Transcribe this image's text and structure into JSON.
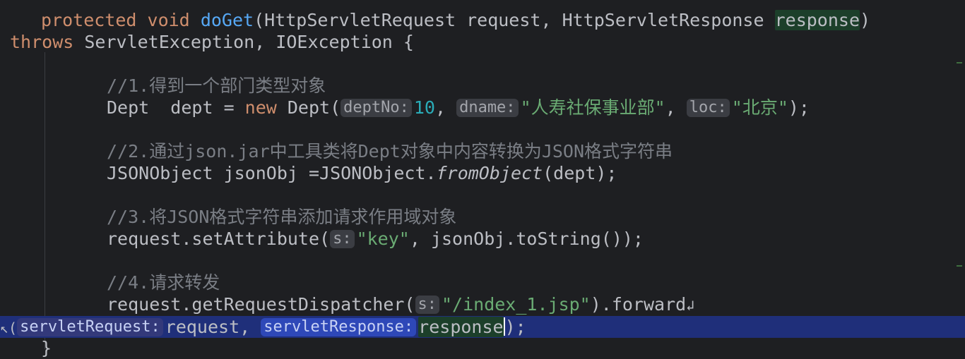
{
  "editor": {
    "lines": {
      "l1": {
        "kw1": "protected",
        "kw2": "void",
        "method": "doGet",
        "params": "(HttpServletRequest request, HttpServletResponse ",
        "param_hl": "response",
        "close": ")"
      },
      "l2": {
        "kw": "throws",
        "rest": " ServletException, IOException {"
      },
      "c1": "//1.得到一个部门类型对象",
      "l3": {
        "type": "Dept  dept = ",
        "kw": "new",
        "ctor": " Dept(",
        "hint1": "deptNo:",
        "num": "10",
        "comma1": ", ",
        "hint2": "dname:",
        "str1": "\"人寿社保事业部\"",
        "comma2": ", ",
        "hint3": "loc:",
        "str2": "\"北京\"",
        "end": ");"
      },
      "c2": "//2.通过json.jar中工具类将Dept对象中内容转换为JSON格式字符串",
      "l4": {
        "pre": "JSONObject jsonObj =JSONObject.",
        "method": "fromObject",
        "post": "(dept);"
      },
      "c3": "//3.将JSON格式字符串添加请求作用域对象",
      "l5": {
        "pre": "request.setAttribute(",
        "hint": "s:",
        "str": "\"key\"",
        "post": ", jsonObj.toString());"
      },
      "c4": "//4.请求转发",
      "l6": {
        "pre": "request.getRequestDispatcher(",
        "hint": "s:",
        "str": "\"/index_1.jsp\"",
        "post": ").forward",
        "wrap": "↲"
      },
      "l7": {
        "lead": "↖(",
        "hint1": "servletRequest:",
        "arg1": "request, ",
        "hint2": "servletResponse:",
        "arg2": "response",
        "end": ");"
      },
      "l8": "}"
    }
  }
}
